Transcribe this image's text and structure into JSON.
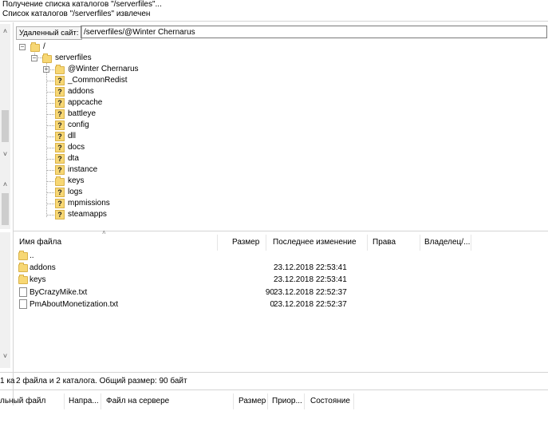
{
  "log": {
    "lines": [
      "Получение списка каталогов \"/serverfiles\"...",
      "Список каталогов \"/serverfiles\" извлечен"
    ]
  },
  "remote_site": {
    "label": "Удаленный сайт:",
    "path": "/serverfiles/@Winter Chernarus"
  },
  "tree": {
    "root": "/",
    "serverfiles": "serverfiles",
    "children": [
      {
        "label": "@Winter Chernarus",
        "icon": "folder"
      },
      {
        "label": "_CommonRedist",
        "icon": "unknown-folder"
      },
      {
        "label": "addons",
        "icon": "unknown-folder"
      },
      {
        "label": "appcache",
        "icon": "unknown-folder"
      },
      {
        "label": "battleye",
        "icon": "unknown-folder"
      },
      {
        "label": "config",
        "icon": "unknown-folder"
      },
      {
        "label": "dll",
        "icon": "unknown-folder"
      },
      {
        "label": "docs",
        "icon": "unknown-folder"
      },
      {
        "label": "dta",
        "icon": "unknown-folder"
      },
      {
        "label": "instance",
        "icon": "unknown-folder"
      },
      {
        "label": "keys",
        "icon": "folder"
      },
      {
        "label": "logs",
        "icon": "unknown-folder"
      },
      {
        "label": "mpmissions",
        "icon": "unknown-folder"
      },
      {
        "label": "steamapps",
        "icon": "unknown-folder"
      }
    ]
  },
  "file_list": {
    "columns": {
      "name": "Имя файла",
      "size": "Размер",
      "modified": "Последнее изменение",
      "permissions": "Права",
      "owner": "Владелец/..."
    },
    "rows": [
      {
        "name": "..",
        "size": "",
        "modified": "",
        "icon": "folder"
      },
      {
        "name": "addons",
        "size": "",
        "modified": "23.12.2018 22:53:41",
        "icon": "folder"
      },
      {
        "name": "keys",
        "size": "",
        "modified": "23.12.2018 22:53:41",
        "icon": "folder"
      },
      {
        "name": "ByCrazyMike.txt",
        "size": "90",
        "modified": "23.12.2018 22:52:37",
        "icon": "file"
      },
      {
        "name": "PmAboutMonetization.txt",
        "size": "0",
        "modified": "23.12.2018 22:52:37",
        "icon": "file"
      }
    ]
  },
  "status": {
    "left_fragment": "1 ка",
    "text": "2 файла и 2 каталога. Общий размер: 90 байт"
  },
  "queue": {
    "columns": {
      "local": "льный файл",
      "direction": "Напра...",
      "remote": "Файл на сервере",
      "size": "Размер",
      "priority": "Приор...",
      "state": "Состояние"
    }
  }
}
